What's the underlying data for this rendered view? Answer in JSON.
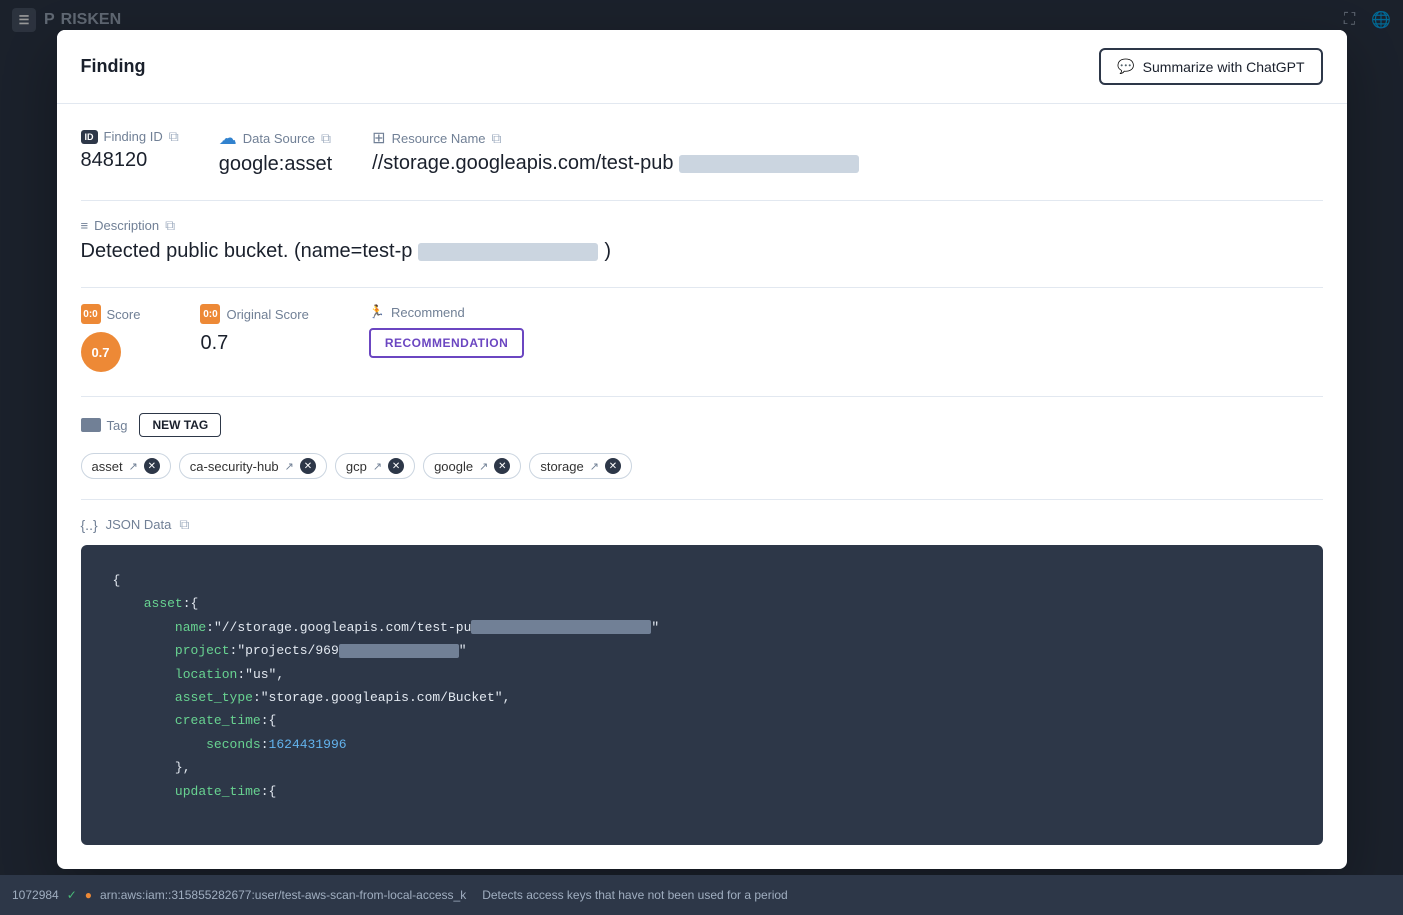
{
  "app": {
    "logo": "P",
    "name": "RISKEN"
  },
  "modal": {
    "title": "Finding",
    "summarize_btn": "Summarize with ChatGPT"
  },
  "finding": {
    "id_label": "Finding ID",
    "id_value": "848120",
    "datasource_label": "Data Source",
    "datasource_value": "google:asset",
    "resource_label": "Resource Name",
    "resource_value": "//storage.googleapis.com/test-pub",
    "description_label": "Description",
    "description_value": "Detected public bucket. (name=test-p",
    "score_label": "Score",
    "score_value": "0.7",
    "score_badge": "0.7",
    "original_score_label": "Original Score",
    "original_score_value": "0.7",
    "recommend_label": "Recommend",
    "recommend_btn": "RECOMMENDATION",
    "tag_label": "Tag",
    "new_tag_btn": "NEW TAG",
    "tags": [
      {
        "label": "asset"
      },
      {
        "label": "ca-security-hub"
      },
      {
        "label": "gcp"
      },
      {
        "label": "google"
      },
      {
        "label": "storage"
      }
    ],
    "json_label": "JSON Data",
    "json_content": {
      "key1": "asset",
      "name_key": "name",
      "name_value": "//storage.googleapis.com/test-pu",
      "project_key": "project",
      "project_value": "\"projects/969",
      "location_key": "location",
      "location_value": "\"us\"",
      "asset_type_key": "asset_type",
      "asset_type_value": "\"storage.googleapis.com/Bucket\"",
      "create_time_key": "create_time",
      "seconds_key": "seconds",
      "seconds_value": "1624431996",
      "update_time_key": "update_time"
    }
  },
  "bottom": {
    "id1": "1072984",
    "text1": "arn:aws:iam::315855282677:user/test-aws-scan-from-local-access_k",
    "text2": "Detects access keys that have not been used for a period"
  }
}
